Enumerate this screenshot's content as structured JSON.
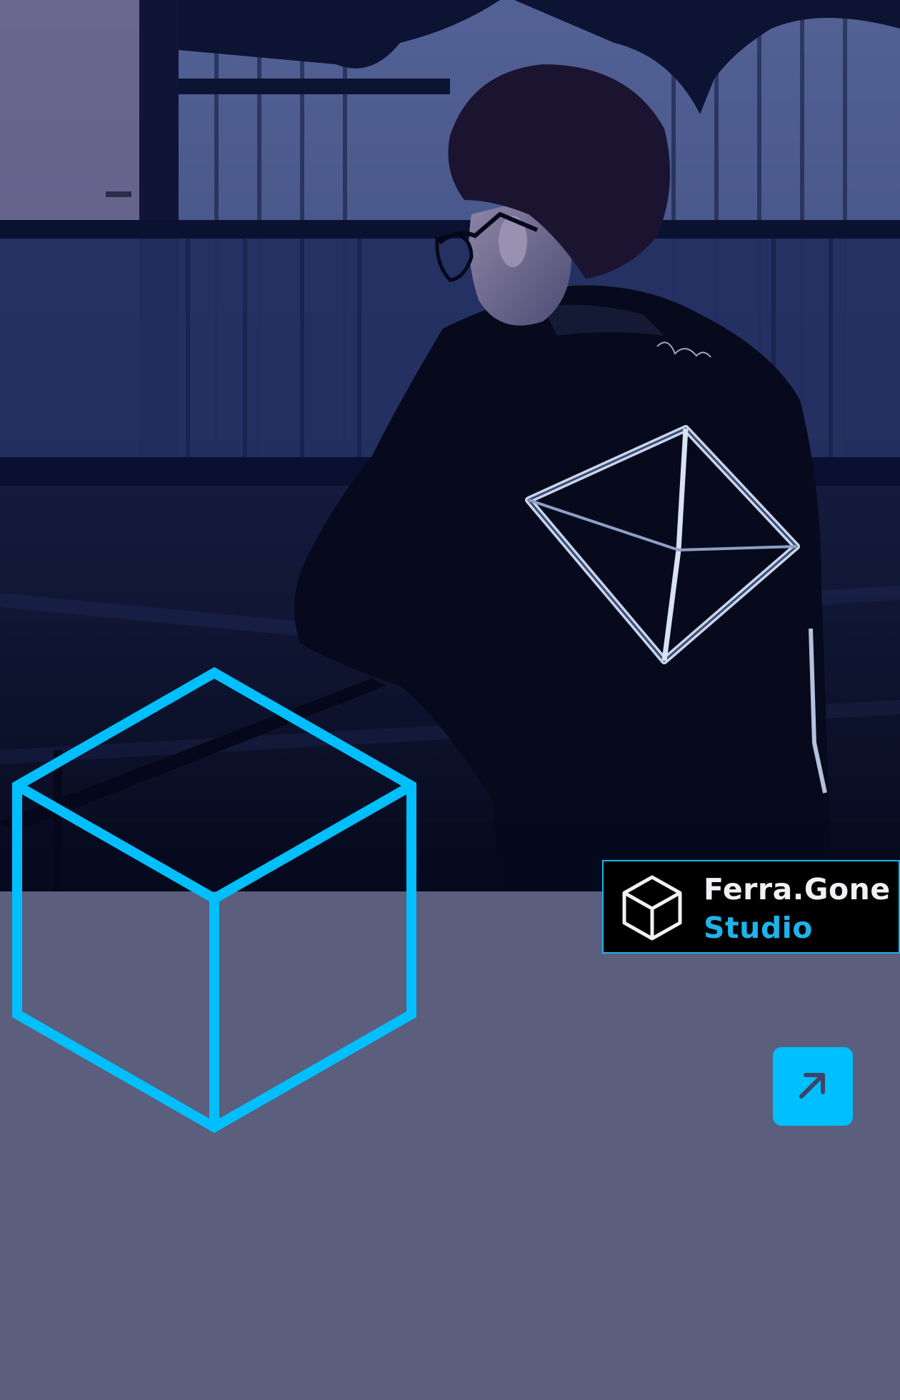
{
  "brand": {
    "name": "Ferra.Gone",
    "subtitle": "Studio",
    "logo_icon": "cube-outline-icon"
  },
  "actions": {
    "open_icon": "arrow-up-right-icon"
  },
  "colors": {
    "background": "#5b5e7c",
    "accent": "#00bfff",
    "card_background": "#000000",
    "brand_text": "#f1f1f4"
  },
  "hero": {
    "image": "photo-person-in-black-jacket-with-geometric-print"
  }
}
